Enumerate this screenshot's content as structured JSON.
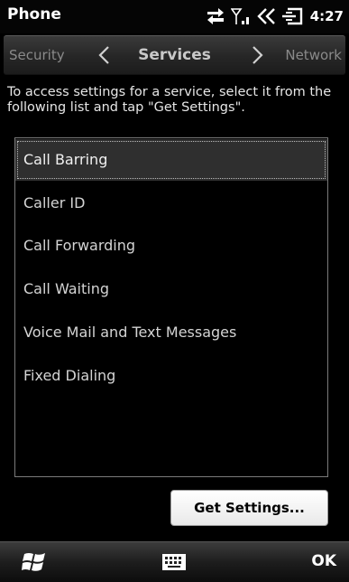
{
  "app": {
    "title": "Phone",
    "time": "4:27"
  },
  "status": {
    "icons": [
      "data-transfer-icon",
      "signal-icon",
      "speaker-icon",
      "battery-charging-icon"
    ]
  },
  "tabs": {
    "previous": "Security",
    "current": "Services",
    "next": "Network"
  },
  "instructions": "To access settings for a service, select it from the following list and tap \"Get Settings\".",
  "services": [
    {
      "label": "Call Barring",
      "selected": true
    },
    {
      "label": "Caller ID",
      "selected": false
    },
    {
      "label": "Call Forwarding",
      "selected": false
    },
    {
      "label": "Call Waiting",
      "selected": false
    },
    {
      "label": "Voice Mail and Text Messages",
      "selected": false
    },
    {
      "label": "Fixed Dialing",
      "selected": false
    }
  ],
  "buttons": {
    "get_settings": "Get Settings..."
  },
  "softkeys": {
    "right": "OK",
    "left_icon": "windows-start-icon",
    "center_icon": "keyboard-icon"
  }
}
